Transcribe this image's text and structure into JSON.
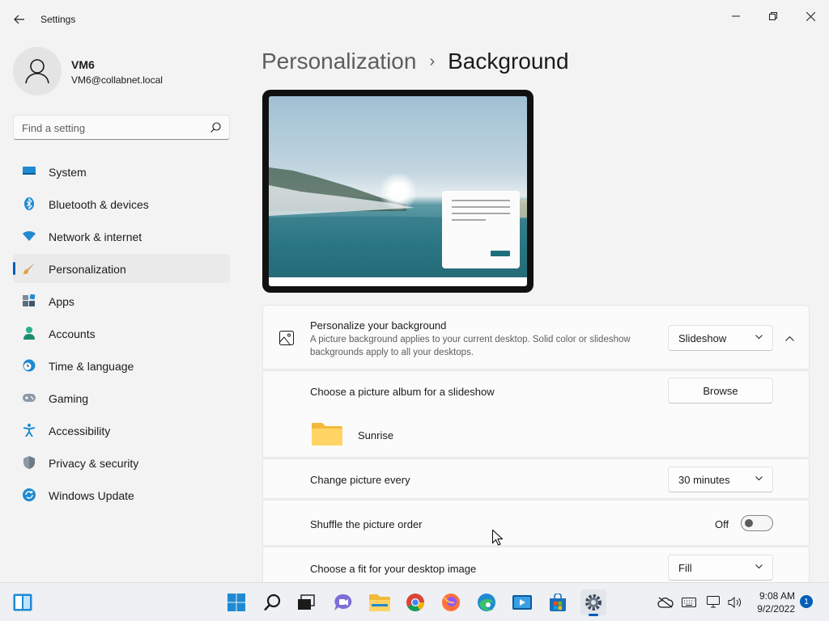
{
  "window": {
    "title": "Settings"
  },
  "profile": {
    "name": "VM6",
    "email": "VM6@collabnet.local"
  },
  "search": {
    "placeholder": "Find a setting"
  },
  "sidebar": {
    "items": [
      {
        "label": "System",
        "icon": "monitor-icon"
      },
      {
        "label": "Bluetooth & devices",
        "icon": "bluetooth-icon"
      },
      {
        "label": "Network & internet",
        "icon": "wifi-icon"
      },
      {
        "label": "Personalization",
        "icon": "brush-icon",
        "selected": true
      },
      {
        "label": "Apps",
        "icon": "apps-icon"
      },
      {
        "label": "Accounts",
        "icon": "accounts-icon"
      },
      {
        "label": "Time & language",
        "icon": "clock-globe-icon"
      },
      {
        "label": "Gaming",
        "icon": "gamepad-icon"
      },
      {
        "label": "Accessibility",
        "icon": "accessibility-icon"
      },
      {
        "label": "Privacy & security",
        "icon": "shield-icon"
      },
      {
        "label": "Windows Update",
        "icon": "update-icon"
      }
    ]
  },
  "breadcrumb": {
    "parent": "Personalization",
    "separator": "›",
    "current": "Background"
  },
  "background": {
    "personalize": {
      "title": "Personalize your background",
      "description": "A picture background applies to your current desktop. Solid color or slideshow backgrounds apply to all your desktops.",
      "value": "Slideshow"
    },
    "album": {
      "title": "Choose a picture album for a slideshow",
      "button": "Browse",
      "folder": "Sunrise"
    },
    "interval": {
      "title": "Change picture every",
      "value": "30 minutes"
    },
    "shuffle": {
      "title": "Shuffle the picture order",
      "state": "Off"
    },
    "fit": {
      "title": "Choose a fit for your desktop image",
      "value": "Fill"
    }
  },
  "taskbar": {
    "time": "9:08 AM",
    "date": "9/2/2022",
    "notifications": "1"
  },
  "colors": {
    "accent": "#005fb8",
    "background": "#f3f3f3",
    "card": "#fbfbfb"
  }
}
